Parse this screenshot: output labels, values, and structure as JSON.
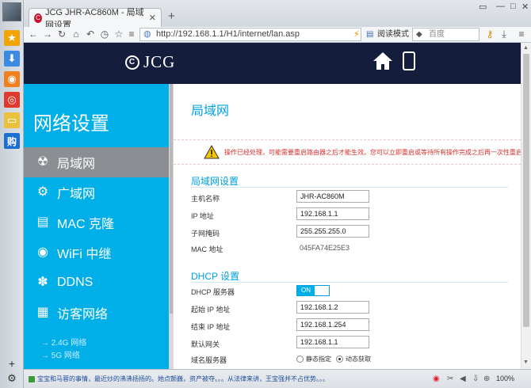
{
  "browser": {
    "tab_title": "JCG JHR-AC860M - 局域网设置",
    "tab_favicon_text": "J",
    "address": "http://192.168.1.1/H1/internet/lan.asp",
    "reader_mode": "阅读模式",
    "search_placeholder": "百度",
    "status_news": "宝宝和马蓉的事情，最近炒的沸沸扬扬的。她点颤巍，资产被夺。。。从法律来讲，王宝强并不占优势。。。",
    "zoom": "100%"
  },
  "dock": {
    "items": [
      {
        "name": "favorites-star",
        "glyph": "★",
        "color": "#f2a400"
      },
      {
        "name": "download",
        "glyph": "⬇",
        "color": "#3d8be0"
      },
      {
        "name": "rss",
        "glyph": "◉",
        "color": "#f08020"
      },
      {
        "name": "weibo",
        "glyph": "◎",
        "color": "#e03a2c"
      },
      {
        "name": "notes",
        "glyph": "▭",
        "color": "#e8c23c"
      },
      {
        "name": "shopping",
        "glyph": "购",
        "color": "#1c6fd0"
      }
    ]
  },
  "header": {
    "logo_mark": "C",
    "logo_text": "JCG"
  },
  "sidebar": {
    "title": "网络设置",
    "items": [
      {
        "label": "局域网",
        "icon": "lan-icon",
        "glyph": "☢",
        "active": true
      },
      {
        "label": "广域网",
        "icon": "wan-icon",
        "glyph": "⚙",
        "active": false
      },
      {
        "label": "MAC 克隆",
        "icon": "mac-clone-icon",
        "glyph": "▤",
        "active": false
      },
      {
        "label": "WiFi 中继",
        "icon": "wifi-repeater-icon",
        "glyph": "◉",
        "active": false
      },
      {
        "label": "DDNS",
        "icon": "ddns-icon",
        "glyph": "✽",
        "active": false
      },
      {
        "label": "访客网络",
        "icon": "guest-network-icon",
        "glyph": "▦",
        "active": false
      }
    ],
    "sub_links": [
      "→ 2.4G 网络",
      "→ 5G 网络"
    ]
  },
  "main": {
    "title": "局域网",
    "warning": "操作已经处理，可能需要重启路由器之后才能生效。您可以立即重启或等待所有操作完成之后再一次性重启。现在要重启吗？",
    "lan_section": {
      "title": "局域网设置",
      "host_label": "主机名称",
      "host_value": "JHR-AC860M",
      "ip_label": "IP 地址",
      "ip_value": "192.168.1.1",
      "mask_label": "子网掩码",
      "mask_value": "255.255.255.0",
      "mac_label": "MAC 地址",
      "mac_value": "045FA74E25E3"
    },
    "dhcp_section": {
      "title": "DHCP 设置",
      "server_label": "DHCP 服务器",
      "server_state": "ON",
      "start_label": "起始 IP 地址",
      "start_value": "192.168.1.2",
      "end_label": "结束 IP 地址",
      "end_value": "192.168.1.254",
      "gateway_label": "默认网关",
      "gateway_value": "192.168.1.1",
      "dns_label": "域名服务器",
      "dns_option_static": "静态指定",
      "dns_option_auto": "动态获取"
    }
  }
}
